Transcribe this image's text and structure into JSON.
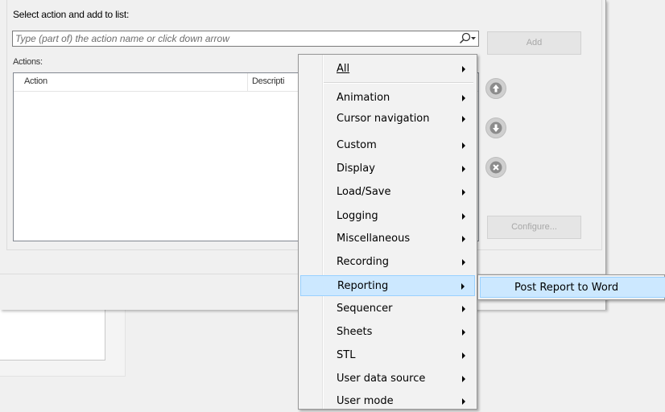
{
  "dialog": {
    "select_label": "Select action and add to list:",
    "input_placeholder": "Type (part of) the action name or click down arrow",
    "actions_label": "Actions:",
    "columns": [
      "Action",
      "Descripti"
    ],
    "add_label": "Add",
    "configure_label": "Configure..."
  },
  "menu": {
    "all": "All",
    "items": [
      "Animation",
      "Cursor navigation",
      "Custom",
      "Display",
      "Load/Save",
      "Logging",
      "Miscellaneous",
      "Recording",
      "Reporting",
      "Sequencer",
      "Sheets",
      "STL",
      "User data source",
      "User mode"
    ],
    "highlighted": "Reporting"
  },
  "submenu": {
    "items": [
      "Post Report to Word"
    ]
  },
  "colors": {
    "highlight_bg": "#cce8ff",
    "highlight_border": "#99d1ff",
    "menu_bg": "#f2f2f2"
  }
}
